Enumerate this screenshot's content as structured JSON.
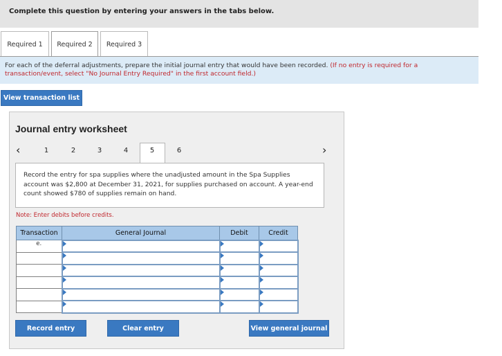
{
  "header": {
    "title": "Complete this question by entering your answers in the tabs below."
  },
  "tabs": [
    {
      "label": "Required 1",
      "active": false
    },
    {
      "label": "Required 2",
      "active": true
    },
    {
      "label": "Required 3",
      "active": false
    }
  ],
  "instruction": {
    "text": "For each of the deferral adjustments, prepare the initial journal entry that would have been recorded.",
    "note": "(If no entry is required for a transaction/event, select \"No Journal Entry Required\" in the first account field.)"
  },
  "view_transaction_list": "View transaction list",
  "worksheet": {
    "title": "Journal entry worksheet",
    "pages": [
      "1",
      "2",
      "3",
      "4",
      "5",
      "6"
    ],
    "active_page": "5",
    "prev_icon": "chevron-left-icon",
    "next_icon": "chevron-right-icon",
    "description": "Record the entry for spa supplies where the unadjusted amount in the Spa Supplies account was $2,800 at December 31, 2021, for supplies purchased on account. A year-end count showed $780 of supplies remain on hand.",
    "note": "Note: Enter debits before credits.",
    "table": {
      "headers": [
        "Transaction",
        "General Journal",
        "Debit",
        "Credit"
      ],
      "rows": [
        {
          "transaction": "e.",
          "account": "",
          "debit": "",
          "credit": ""
        },
        {
          "transaction": "",
          "account": "",
          "debit": "",
          "credit": ""
        },
        {
          "transaction": "",
          "account": "",
          "debit": "",
          "credit": ""
        },
        {
          "transaction": "",
          "account": "",
          "debit": "",
          "credit": ""
        },
        {
          "transaction": "",
          "account": "",
          "debit": "",
          "credit": ""
        },
        {
          "transaction": "",
          "account": "",
          "debit": "",
          "credit": ""
        }
      ]
    },
    "buttons": {
      "record": "Record entry",
      "clear": "Clear entry",
      "view_journal": "View general journal"
    }
  },
  "colors": {
    "accent": "#3a79c1",
    "instruction_bg": "#dcebf7",
    "table_header_bg": "#a8c8e8",
    "note_red": "#c0262c"
  }
}
